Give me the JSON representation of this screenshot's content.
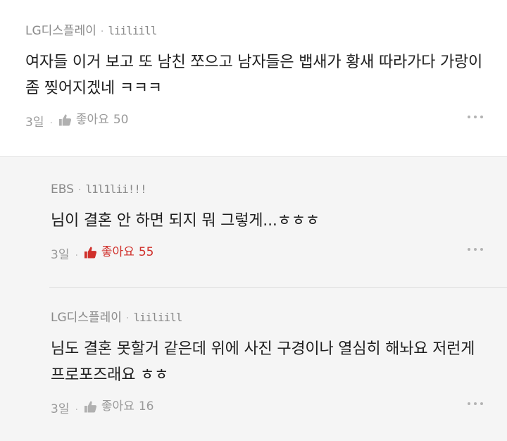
{
  "comments": [
    {
      "author": "LG디스플레이",
      "nickname": "liiliill",
      "text": "여자들 이거 보고 또 남친 쪼으고 남자들은 뱁새가 황새 따라가다 가랑이 좀 찢어지겠네 ㅋㅋㅋ",
      "time": "3일",
      "like_label": "좋아요",
      "like_count": "50",
      "liked": false
    },
    {
      "author": "EBS",
      "nickname": "l1l1lii!!!",
      "text": "님이 결혼 안 하면 되지 뭐 그렇게...ㅎㅎㅎ",
      "time": "3일",
      "like_label": "좋아요",
      "like_count": "55",
      "liked": true
    },
    {
      "author": "LG디스플레이",
      "nickname": "liiliill",
      "text": "님도 결혼 못할거 같은데 위에 사진 구경이나 열심히 해놔요 저런게 프로포즈래요 ㅎㅎ",
      "time": "3일",
      "like_label": "좋아요",
      "like_count": "16",
      "liked": false
    }
  ],
  "separator": "·",
  "icons": {
    "like": "thumbs-up-icon",
    "more": "more-dots-icon"
  },
  "colors": {
    "liked": "#d0302b",
    "muted": "#9a9a9a",
    "reply_bg": "#f5f5f5"
  }
}
